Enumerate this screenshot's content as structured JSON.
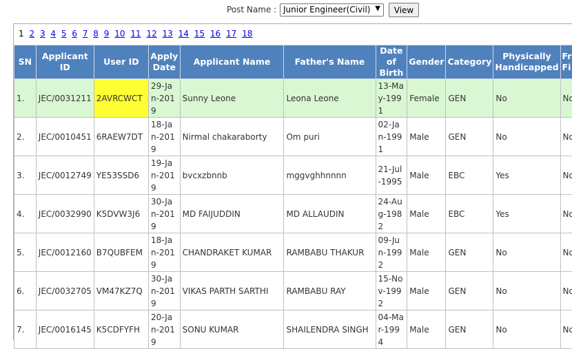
{
  "filter": {
    "label": "Post Name :",
    "selected_post": "Junior Engineer(Civil)",
    "chevron": "▼",
    "view_label": "View"
  },
  "pager": {
    "current": "1",
    "links": [
      "2",
      "3",
      "4",
      "5",
      "6",
      "7",
      "8",
      "9",
      "10",
      "11",
      "12",
      "13",
      "14",
      "15",
      "16",
      "17",
      "18"
    ]
  },
  "table": {
    "headers": {
      "sn": "SN",
      "applicant_id": "Applicant ID",
      "user_id": "User ID",
      "apply_date": "Apply Date",
      "applicant_name": "Applicant Name",
      "father_name": "Father's Name",
      "dob": "Date of Birth",
      "gender": "Gender",
      "category": "Category",
      "ph": "Physically Handicapped",
      "freedom": "Fre Fi"
    },
    "rows": [
      {
        "sn": "1.",
        "applicant_id": "JEC/0031211",
        "user_id": "2AVRCWCT",
        "apply_date": "29-Jan-2019",
        "applicant_name": "Sunny Leone",
        "father_name": "Leona Leone",
        "dob": "13-May-1991",
        "gender": "Female",
        "category": "GEN",
        "ph": "No",
        "freedom": "No"
      },
      {
        "sn": "2.",
        "applicant_id": "JEC/0010451",
        "user_id": "6RAEW7DT",
        "apply_date": "18-Jan-2019",
        "applicant_name": "Nirmal chakaraborty",
        "father_name": "Om puri",
        "dob": "02-Jan-1991",
        "gender": "Male",
        "category": "GEN",
        "ph": "No",
        "freedom": "No"
      },
      {
        "sn": "3.",
        "applicant_id": "JEC/0012749",
        "user_id": "YE53SSD6",
        "apply_date": "19-Jan-2019",
        "applicant_name": "bvcxzbnnb",
        "father_name": "mggvghhnnnn",
        "dob": "21-Jul-1995",
        "gender": "Male",
        "category": "EBC",
        "ph": "Yes",
        "freedom": "No"
      },
      {
        "sn": "4.",
        "applicant_id": "JEC/0032990",
        "user_id": "K5DVW3J6",
        "apply_date": "30-Jan-2019",
        "applicant_name": "MD FAIJUDDIN",
        "father_name": "MD ALLAUDIN",
        "dob": "24-Aug-1982",
        "gender": "Male",
        "category": "EBC",
        "ph": "Yes",
        "freedom": "No"
      },
      {
        "sn": "5.",
        "applicant_id": "JEC/0012160",
        "user_id": "B7QUBFEM",
        "apply_date": "18-Jan-2019",
        "applicant_name": "CHANDRAKET KUMAR",
        "father_name": "RAMBABU THAKUR",
        "dob": "09-Jun-1992",
        "gender": "Male",
        "category": "GEN",
        "ph": "No",
        "freedom": "No"
      },
      {
        "sn": "6.",
        "applicant_id": "JEC/0032705",
        "user_id": "VM47KZ7Q",
        "apply_date": "30-Jan-2019",
        "applicant_name": "VIKAS PARTH SARTHI",
        "father_name": "RAMBABU RAY",
        "dob": "15-Nov-1992",
        "gender": "Male",
        "category": "GEN",
        "ph": "No",
        "freedom": "No"
      },
      {
        "sn": "7.",
        "applicant_id": "JEC/0016145",
        "user_id": "K5CDFYFH",
        "apply_date": "20-Jan-2019",
        "applicant_name": "SONU KUMAR",
        "father_name": "SHAILENDRA SINGH",
        "dob": "04-Mar-1994",
        "gender": "Male",
        "category": "GEN",
        "ph": "No",
        "freedom": "No"
      }
    ]
  },
  "colors": {
    "header_bg": "#4f81bd",
    "selected_row_bg": "#d9f7d3",
    "highlight_cell_bg": "#ffff33",
    "link": "#0000ee"
  }
}
